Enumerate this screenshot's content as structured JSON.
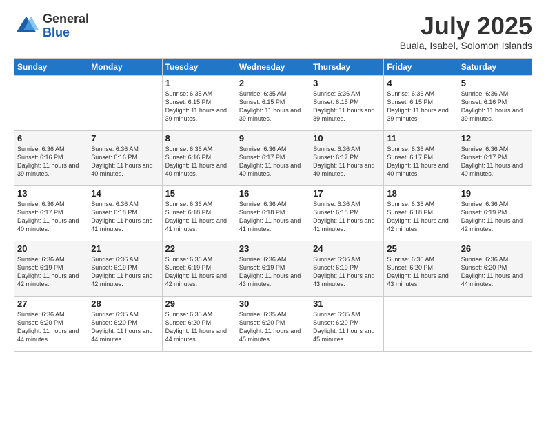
{
  "logo": {
    "general": "General",
    "blue": "Blue"
  },
  "title": "July 2025",
  "subtitle": "Buala, Isabel, Solomon Islands",
  "days_of_week": [
    "Sunday",
    "Monday",
    "Tuesday",
    "Wednesday",
    "Thursday",
    "Friday",
    "Saturday"
  ],
  "weeks": [
    [
      {
        "day": "",
        "info": ""
      },
      {
        "day": "",
        "info": ""
      },
      {
        "day": "1",
        "info": "Sunrise: 6:35 AM\nSunset: 6:15 PM\nDaylight: 11 hours and 39 minutes."
      },
      {
        "day": "2",
        "info": "Sunrise: 6:35 AM\nSunset: 6:15 PM\nDaylight: 11 hours and 39 minutes."
      },
      {
        "day": "3",
        "info": "Sunrise: 6:36 AM\nSunset: 6:15 PM\nDaylight: 11 hours and 39 minutes."
      },
      {
        "day": "4",
        "info": "Sunrise: 6:36 AM\nSunset: 6:15 PM\nDaylight: 11 hours and 39 minutes."
      },
      {
        "day": "5",
        "info": "Sunrise: 6:36 AM\nSunset: 6:16 PM\nDaylight: 11 hours and 39 minutes."
      }
    ],
    [
      {
        "day": "6",
        "info": "Sunrise: 6:36 AM\nSunset: 6:16 PM\nDaylight: 11 hours and 39 minutes."
      },
      {
        "day": "7",
        "info": "Sunrise: 6:36 AM\nSunset: 6:16 PM\nDaylight: 11 hours and 40 minutes."
      },
      {
        "day": "8",
        "info": "Sunrise: 6:36 AM\nSunset: 6:16 PM\nDaylight: 11 hours and 40 minutes."
      },
      {
        "day": "9",
        "info": "Sunrise: 6:36 AM\nSunset: 6:17 PM\nDaylight: 11 hours and 40 minutes."
      },
      {
        "day": "10",
        "info": "Sunrise: 6:36 AM\nSunset: 6:17 PM\nDaylight: 11 hours and 40 minutes."
      },
      {
        "day": "11",
        "info": "Sunrise: 6:36 AM\nSunset: 6:17 PM\nDaylight: 11 hours and 40 minutes."
      },
      {
        "day": "12",
        "info": "Sunrise: 6:36 AM\nSunset: 6:17 PM\nDaylight: 11 hours and 40 minutes."
      }
    ],
    [
      {
        "day": "13",
        "info": "Sunrise: 6:36 AM\nSunset: 6:17 PM\nDaylight: 11 hours and 40 minutes."
      },
      {
        "day": "14",
        "info": "Sunrise: 6:36 AM\nSunset: 6:18 PM\nDaylight: 11 hours and 41 minutes."
      },
      {
        "day": "15",
        "info": "Sunrise: 6:36 AM\nSunset: 6:18 PM\nDaylight: 11 hours and 41 minutes."
      },
      {
        "day": "16",
        "info": "Sunrise: 6:36 AM\nSunset: 6:18 PM\nDaylight: 11 hours and 41 minutes."
      },
      {
        "day": "17",
        "info": "Sunrise: 6:36 AM\nSunset: 6:18 PM\nDaylight: 11 hours and 41 minutes."
      },
      {
        "day": "18",
        "info": "Sunrise: 6:36 AM\nSunset: 6:18 PM\nDaylight: 11 hours and 42 minutes."
      },
      {
        "day": "19",
        "info": "Sunrise: 6:36 AM\nSunset: 6:19 PM\nDaylight: 11 hours and 42 minutes."
      }
    ],
    [
      {
        "day": "20",
        "info": "Sunrise: 6:36 AM\nSunset: 6:19 PM\nDaylight: 11 hours and 42 minutes."
      },
      {
        "day": "21",
        "info": "Sunrise: 6:36 AM\nSunset: 6:19 PM\nDaylight: 11 hours and 42 minutes."
      },
      {
        "day": "22",
        "info": "Sunrise: 6:36 AM\nSunset: 6:19 PM\nDaylight: 11 hours and 42 minutes."
      },
      {
        "day": "23",
        "info": "Sunrise: 6:36 AM\nSunset: 6:19 PM\nDaylight: 11 hours and 43 minutes."
      },
      {
        "day": "24",
        "info": "Sunrise: 6:36 AM\nSunset: 6:19 PM\nDaylight: 11 hours and 43 minutes."
      },
      {
        "day": "25",
        "info": "Sunrise: 6:36 AM\nSunset: 6:20 PM\nDaylight: 11 hours and 43 minutes."
      },
      {
        "day": "26",
        "info": "Sunrise: 6:36 AM\nSunset: 6:20 PM\nDaylight: 11 hours and 44 minutes."
      }
    ],
    [
      {
        "day": "27",
        "info": "Sunrise: 6:36 AM\nSunset: 6:20 PM\nDaylight: 11 hours and 44 minutes."
      },
      {
        "day": "28",
        "info": "Sunrise: 6:35 AM\nSunset: 6:20 PM\nDaylight: 11 hours and 44 minutes."
      },
      {
        "day": "29",
        "info": "Sunrise: 6:35 AM\nSunset: 6:20 PM\nDaylight: 11 hours and 44 minutes."
      },
      {
        "day": "30",
        "info": "Sunrise: 6:35 AM\nSunset: 6:20 PM\nDaylight: 11 hours and 45 minutes."
      },
      {
        "day": "31",
        "info": "Sunrise: 6:35 AM\nSunset: 6:20 PM\nDaylight: 11 hours and 45 minutes."
      },
      {
        "day": "",
        "info": ""
      },
      {
        "day": "",
        "info": ""
      }
    ]
  ]
}
